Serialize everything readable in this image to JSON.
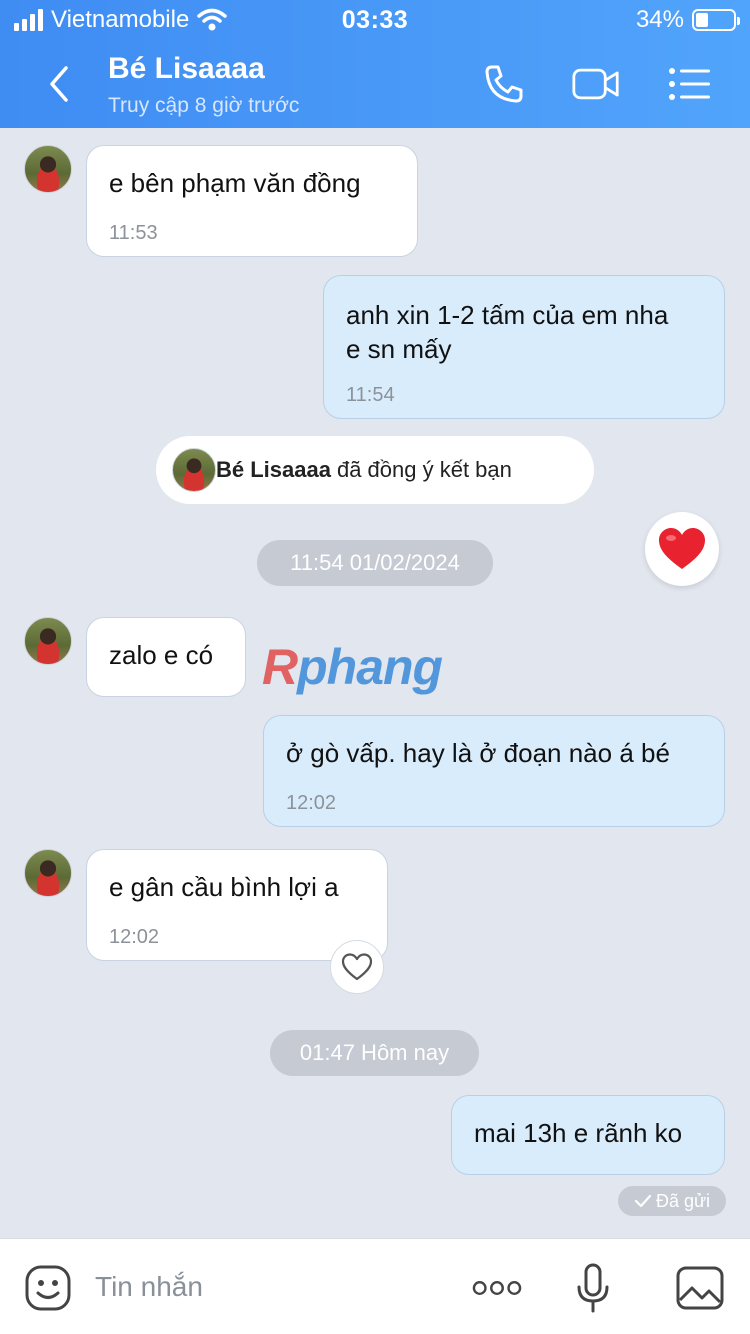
{
  "status_bar": {
    "carrier": "Vietnamobile",
    "time": "03:33",
    "battery_text": "34%",
    "battery_level": 0.34
  },
  "header": {
    "contact_name": "Bé Lisaaaa",
    "contact_status": "Truy cập 8 giờ trước",
    "icons": [
      "back-icon",
      "phone-icon",
      "video-call-icon",
      "menu-icon"
    ]
  },
  "messages": [
    {
      "direction": "in",
      "text": "e bên phạm văn đồng",
      "time": "11:53"
    },
    {
      "direction": "out",
      "text": "anh xin 1-2 tấm của em nha\ne sn mấy",
      "time": "11:54"
    },
    {
      "direction": "in",
      "text": "zalo e có",
      "time": ""
    },
    {
      "direction": "out",
      "text": "ở gò vấp. hay là ở đoạn nào á bé",
      "time": "12:02"
    },
    {
      "direction": "in",
      "text": "e gân cầu bình lợi a",
      "time": "12:02"
    },
    {
      "direction": "out",
      "text": "mai 13h e rãnh ko",
      "time": ""
    }
  ],
  "friend_notice": {
    "name": "Bé Lisaaaa",
    "text": "đã đồng ý kết bạn"
  },
  "date_separators": [
    "11:54 01/02/2024",
    "01:47 Hôm nay"
  ],
  "watermark": {
    "r": "R",
    "rest": "phang"
  },
  "sent_status": "Đã gửi",
  "input_bar": {
    "placeholder": "Tin nhắn",
    "icons": [
      "sticker-icon",
      "more-icon",
      "microphone-icon",
      "image-icon"
    ]
  },
  "colors": {
    "header_start": "#3f8cf3",
    "header_end": "#51a4fb",
    "outgoing_bubble": "#d9ecfb",
    "incoming_bubble": "#ffffff",
    "background": "#e2e6ee",
    "reaction_heart": "#e8232f"
  }
}
